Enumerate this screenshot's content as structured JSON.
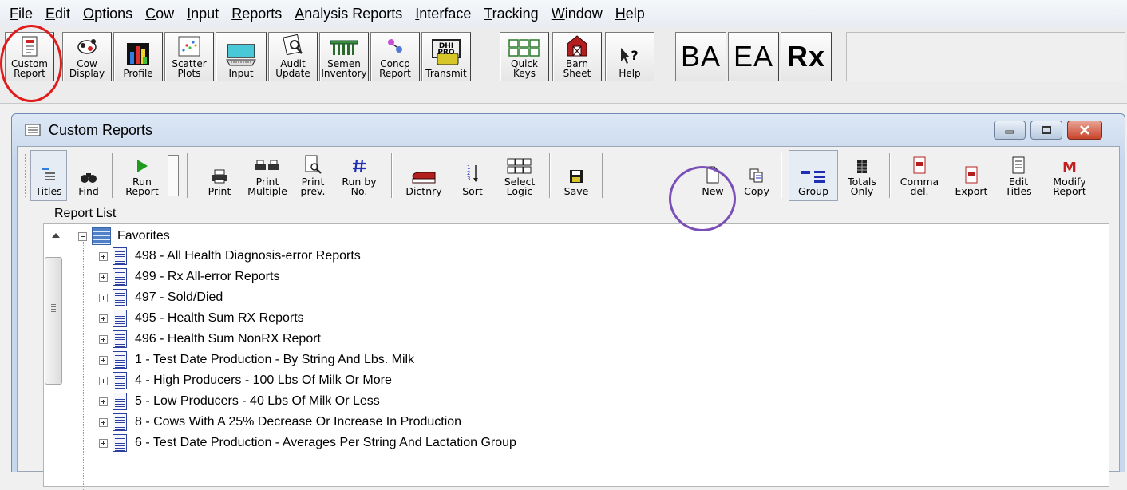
{
  "menu": [
    {
      "label": "File",
      "underline": "F"
    },
    {
      "label": "Edit",
      "underline": "E"
    },
    {
      "label": "Options",
      "underline": "O"
    },
    {
      "label": "Cow",
      "underline": "C"
    },
    {
      "label": "Input",
      "underline": "I"
    },
    {
      "label": "Reports",
      "underline": "R"
    },
    {
      "label": "Analysis Reports",
      "underline": "A"
    },
    {
      "label": "Interface",
      "underline": "I"
    },
    {
      "label": "Tracking",
      "underline": "T"
    },
    {
      "label": "Window",
      "underline": "W"
    },
    {
      "label": "Help",
      "underline": "H"
    }
  ],
  "toolbar": {
    "custom_report": "Custom\nReport",
    "cow_display": "Cow\nDisplay",
    "profile": "Profile",
    "scatter_plots": "Scatter\nPlots",
    "input": "Input",
    "audit_update": "Audit\nUpdate",
    "semen_inventory": "Semen\nInventory",
    "concp_report": "Concp\nReport",
    "transmit": "Transmit",
    "transmit_icon_text": "DHI\nPRO",
    "quick_keys": "Quick\nKeys",
    "barn_sheet": "Barn\nSheet",
    "help": "Help",
    "ba": "BA",
    "ea": "EA",
    "rx": "Rx"
  },
  "window": {
    "title": "Custom Reports"
  },
  "report_toolbar": {
    "titles": "Titles",
    "find": "Find",
    "run_report": "Run\nReport",
    "print": "Print",
    "print_multiple": "Print\nMultiple",
    "print_prev": "Print\nprev.",
    "run_by_no": "Run by\nNo.",
    "dictnry": "Dictnry",
    "sort": "Sort",
    "select_logic": "Select\nLogic",
    "save": "Save",
    "new": "New",
    "copy": "Copy",
    "group": "Group",
    "totals_only": "Totals\nOnly",
    "comma_del": "Comma\ndel.",
    "export": "Export",
    "edit_titles": "Edit\nTitles",
    "modify_report": "Modify\nReport"
  },
  "report_list": {
    "label": "Report List",
    "root": "Favorites",
    "items": [
      "498 - All Health Diagnosis-error Reports",
      "499 - Rx All-error Reports",
      "497 - Sold/Died",
      "495 - Health Sum RX Reports",
      "496 - Health Sum NonRX Report",
      "1 - Test Date Production - By String And Lbs. Milk",
      "4 - High Producers - 100 Lbs Of Milk Or More",
      "5 - Low Producers - 40 Lbs Of Milk Or Less",
      "8 - Cows With A 25% Decrease Or Increase In Production",
      "6 - Test Date Production - Averages Per String And Lactation Group"
    ]
  },
  "colors": {
    "highlight_red": "#e01b1b",
    "highlight_purple": "#7b4fb8"
  }
}
